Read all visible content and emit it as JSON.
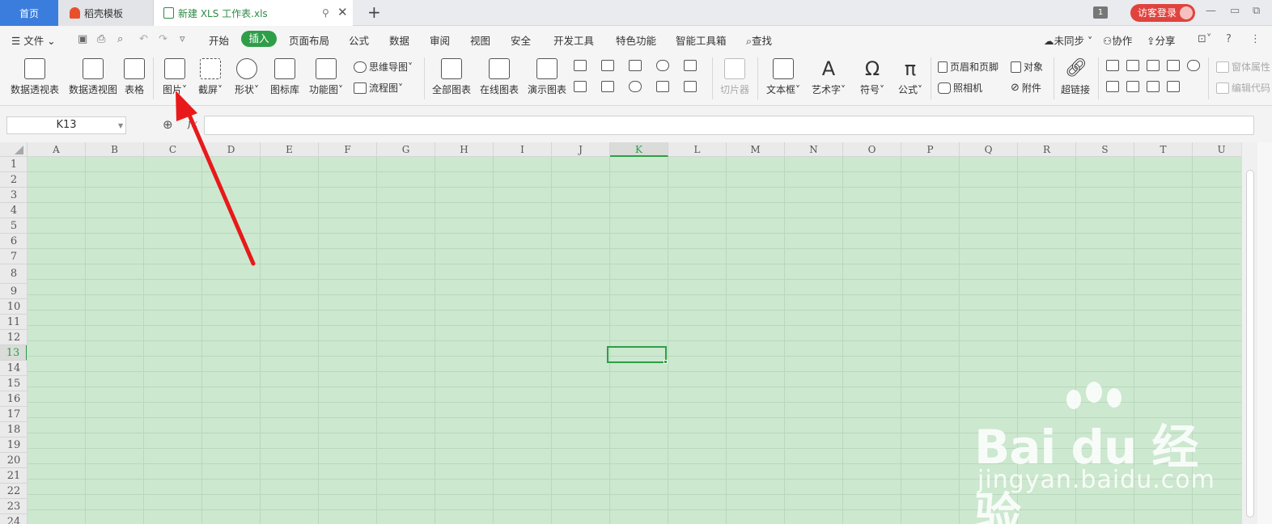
{
  "tabs": {
    "home": "首页",
    "template": "稻壳模板",
    "file": "新建 XLS 工作表.xls",
    "count_badge": "1",
    "login": "访客登录"
  },
  "menu": {
    "file": "文件",
    "items": [
      "开始",
      "插入",
      "页面布局",
      "公式",
      "数据",
      "审阅",
      "视图",
      "安全",
      "开发工具",
      "特色功能",
      "智能工具箱",
      "查找"
    ],
    "sync": "未同步",
    "collab": "协作",
    "share": "分享"
  },
  "ribbon": {
    "pivot_table": "数据透视表",
    "pivot_chart": "数据透视图",
    "table": "表格",
    "picture": "图片",
    "screenshot": "截屏",
    "shape": "形状",
    "icon_lib": "图标库",
    "func_chart": "功能图",
    "mindmap": "思维导图",
    "flowchart": "流程图",
    "all_charts": "全部图表",
    "online_chart": "在线图表",
    "demo_chart": "演示图表",
    "slicer": "切片器",
    "textbox": "文本框",
    "art_text": "艺术字",
    "symbol": "符号",
    "formula": "公式",
    "header_footer": "页眉和页脚",
    "object": "对象",
    "camera": "照相机",
    "attachment": "附件",
    "hyperlink": "超链接",
    "window_props": "窗体属性",
    "edit_code": "编辑代码"
  },
  "formula_bar": {
    "name_box": "K13",
    "fx": "fx"
  },
  "grid": {
    "columns": [
      "A",
      "B",
      "C",
      "D",
      "E",
      "F",
      "G",
      "H",
      "I",
      "J",
      "K",
      "L",
      "M",
      "N",
      "O",
      "P",
      "Q",
      "R",
      "S",
      "T",
      "U"
    ],
    "rows": [
      "1",
      "2",
      "3",
      "4",
      "5",
      "6",
      "7",
      "8",
      "9",
      "10",
      "11",
      "12",
      "13",
      "14",
      "15",
      "16",
      "17",
      "18",
      "19",
      "20",
      "21",
      "22",
      "23",
      "24"
    ],
    "selected_col": "K",
    "selected_row": "13"
  },
  "watermark": {
    "logo": "Bai du 经验",
    "url": "jingyan.baidu.com"
  },
  "colors": {
    "accent_green": "#2e9e48",
    "home_tab_blue": "#3b7ddd",
    "login_red": "#e0433e",
    "cell_fill": "#cce8cf",
    "arrow_red": "#e8191a"
  }
}
